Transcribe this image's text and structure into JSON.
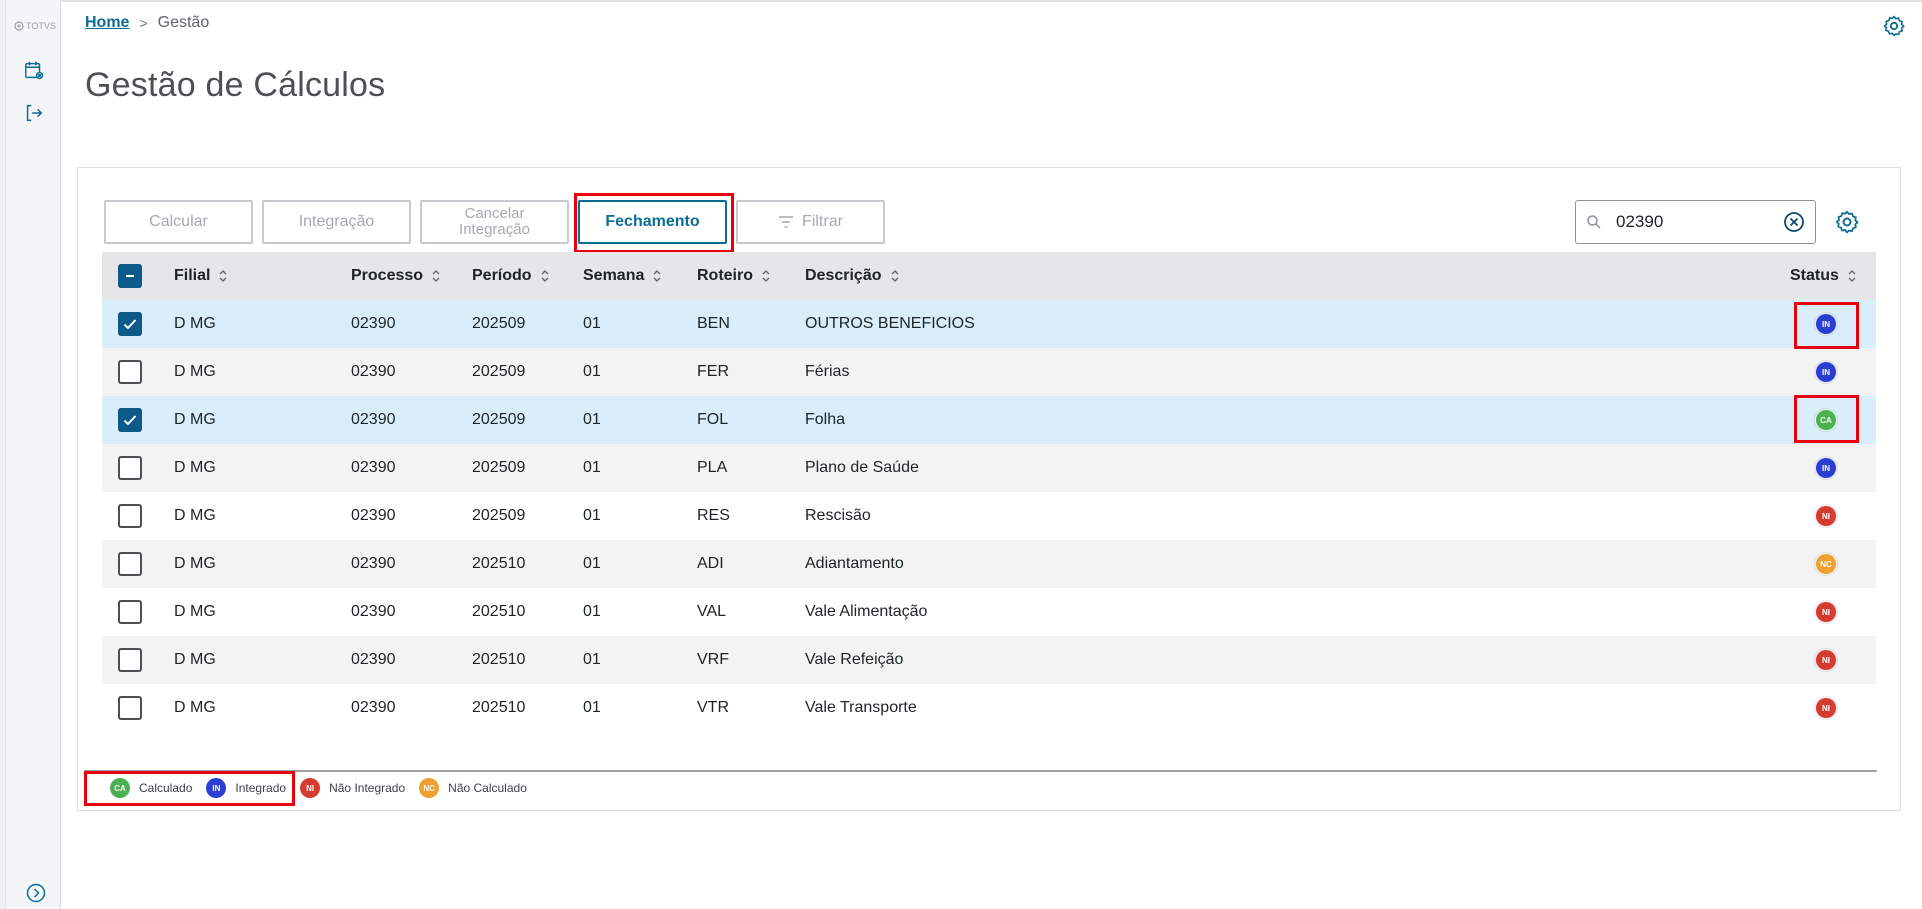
{
  "app": {
    "brand": "TOTVS"
  },
  "breadcrumb": {
    "home": "Home",
    "separator": ">",
    "current": "Gestão"
  },
  "page": {
    "title": "Gestão de Cálculos"
  },
  "toolbar": {
    "calcular": "Calcular",
    "integracao": "Integração",
    "cancelar_integracao": "Cancelar Integração",
    "fechamento": "Fechamento",
    "filtrar": "Filtrar"
  },
  "search": {
    "value": "02390"
  },
  "table": {
    "columns": {
      "filial": "Filial",
      "processo": "Processo",
      "periodo": "Período",
      "semana": "Semana",
      "roteiro": "Roteiro",
      "descricao": "Descrição",
      "status": "Status"
    },
    "rows": [
      {
        "checked": true,
        "filial": "D MG",
        "processo": "02390",
        "periodo": "202509",
        "semana": "01",
        "roteiro": "BEN",
        "descricao": "OUTROS BENEFICIOS",
        "status": "IN"
      },
      {
        "checked": false,
        "filial": "D MG",
        "processo": "02390",
        "periodo": "202509",
        "semana": "01",
        "roteiro": "FER",
        "descricao": "Férias",
        "status": "IN"
      },
      {
        "checked": true,
        "filial": "D MG",
        "processo": "02390",
        "periodo": "202509",
        "semana": "01",
        "roteiro": "FOL",
        "descricao": "Folha",
        "status": "CA"
      },
      {
        "checked": false,
        "filial": "D MG",
        "processo": "02390",
        "periodo": "202509",
        "semana": "01",
        "roteiro": "PLA",
        "descricao": "Plano de Saúde",
        "status": "IN"
      },
      {
        "checked": false,
        "filial": "D MG",
        "processo": "02390",
        "periodo": "202509",
        "semana": "01",
        "roteiro": "RES",
        "descricao": "Rescisão",
        "status": "NI"
      },
      {
        "checked": false,
        "filial": "D MG",
        "processo": "02390",
        "periodo": "202510",
        "semana": "01",
        "roteiro": "ADI",
        "descricao": "Adiantamento",
        "status": "NC"
      },
      {
        "checked": false,
        "filial": "D MG",
        "processo": "02390",
        "periodo": "202510",
        "semana": "01",
        "roteiro": "VAL",
        "descricao": "Vale Alimentação",
        "status": "NI"
      },
      {
        "checked": false,
        "filial": "D MG",
        "processo": "02390",
        "periodo": "202510",
        "semana": "01",
        "roteiro": "VRF",
        "descricao": "Vale Refeição",
        "status": "NI"
      },
      {
        "checked": false,
        "filial": "D MG",
        "processo": "02390",
        "periodo": "202510",
        "semana": "01",
        "roteiro": "VTR",
        "descricao": "Vale Transporte",
        "status": "NI"
      }
    ]
  },
  "legend": [
    {
      "code": "CA",
      "label": "Calculado"
    },
    {
      "code": "IN",
      "label": "Integrado"
    },
    {
      "code": "NI",
      "label": "Não Integrado"
    },
    {
      "code": "NC",
      "label": "Não Calculado"
    }
  ],
  "status_colors": {
    "CA": "#4caf50",
    "IN": "#2a3fd1",
    "NI": "#d63b2f",
    "NC": "#f0a030"
  },
  "colors": {
    "accent": "#0c6c94",
    "highlight": "#e8000b",
    "selected_row": "#d9eefa"
  }
}
